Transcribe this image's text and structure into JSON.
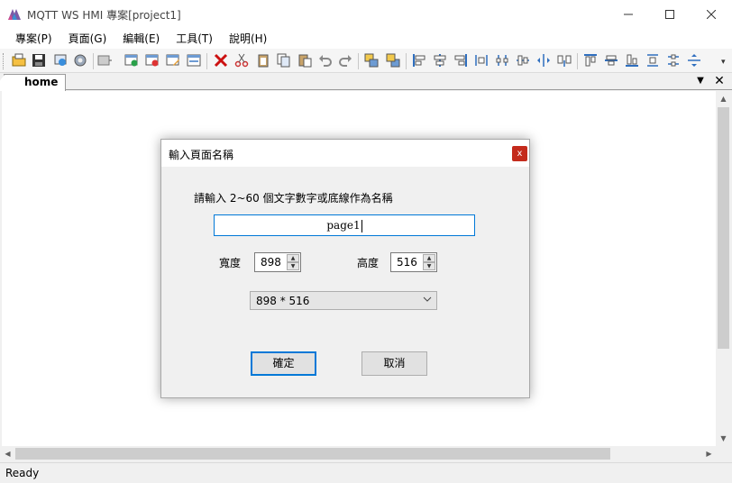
{
  "window": {
    "title": "MQTT WS HMI 專案[project1]",
    "icon": "app-logo-icon",
    "controls": {
      "minimize": "—",
      "maximize": "☐",
      "close": "✕"
    }
  },
  "menu": [
    {
      "label": "專案(P)"
    },
    {
      "label": "頁面(G)"
    },
    {
      "label": "編輯(E)"
    },
    {
      "label": "工具(T)"
    },
    {
      "label": "說明(H)"
    }
  ],
  "toolbar": {
    "icons": [
      "open-folder-icon",
      "save-icon",
      "publish-icon",
      "settings-icon",
      "page-list-icon",
      "add-page-icon",
      "delete-page-icon",
      "rename-page-icon",
      "page-properties-icon",
      "delete-icon",
      "cut-icon",
      "paste-special-icon",
      "copy-icon",
      "paste-icon",
      "undo-icon",
      "redo-icon",
      "bring-front-icon",
      "send-back-icon",
      "align-left-icon",
      "align-center-icon",
      "align-right-icon",
      "distribute-horizontal-icon",
      "distribute-horizontal-center-icon",
      "align-middle-icon",
      "space-horizontal-icon",
      "center-horizontal-icon",
      "align-top-icon",
      "align-vertical-center-icon",
      "align-bottom-icon",
      "distribute-vertical-icon",
      "distribute-vertical-center-icon",
      "space-vertical-icon"
    ],
    "overflow": "▾"
  },
  "tabs": [
    {
      "label": "home"
    }
  ],
  "tab_controls": {
    "dropdown": "▼",
    "close": "✕"
  },
  "status": {
    "text": "Ready"
  },
  "dialog": {
    "title": "輸入頁面名稱",
    "close": "x",
    "prompt": "請輸入 2~60 個文字數字或底線作為名稱",
    "name_value": "page1",
    "width_label": "寬度",
    "width_value": "898",
    "height_label": "高度",
    "height_value": "516",
    "size_select": "898 * 516",
    "ok_label": "確定",
    "cancel_label": "取消"
  },
  "colors": {
    "accent": "#0078d7",
    "close_red": "#c42b1c",
    "delete_red": "#cc1111"
  }
}
